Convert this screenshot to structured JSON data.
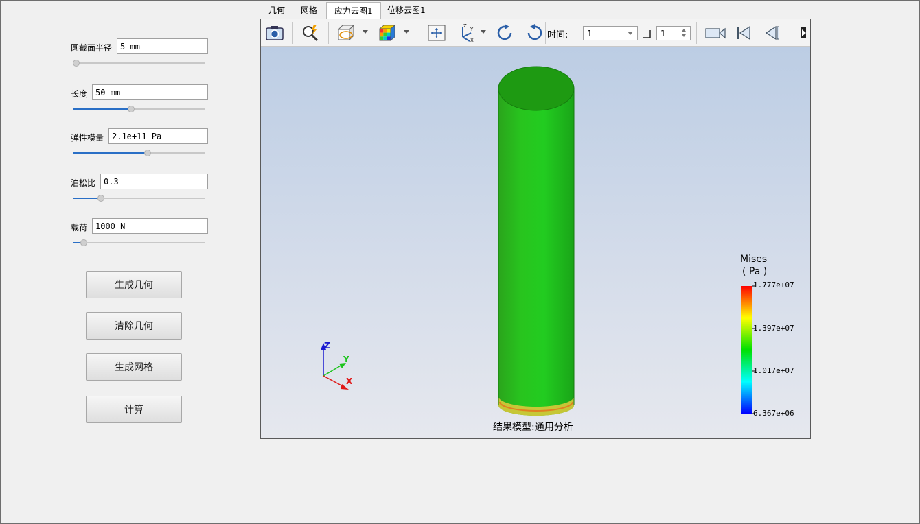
{
  "params": [
    {
      "label": "圆截面半径",
      "value": "5 mm",
      "slider": 0.02
    },
    {
      "label": "长度",
      "value": "50 mm",
      "slider": 0.44
    },
    {
      "label": "弹性模量",
      "value": "2.1e+11 Pa",
      "slider": 0.56
    },
    {
      "label": "泊松比",
      "value": "0.3",
      "slider": 0.21
    },
    {
      "label": "载荷",
      "value": "1000 N",
      "slider": 0.08
    }
  ],
  "buttons": {
    "generate_geometry": "生成几何",
    "clear_geometry": "清除几何",
    "generate_mesh": "生成网格",
    "compute": "计算"
  },
  "tabs": [
    {
      "label": "几何",
      "active": false
    },
    {
      "label": "网格",
      "active": false
    },
    {
      "label": "应力云图1",
      "active": true
    },
    {
      "label": "位移云图1",
      "active": false
    }
  ],
  "toolbar": {
    "time_label": "时间:",
    "time_value": "1",
    "step_value": "1",
    "icons": [
      "camera-icon",
      "zoom-icon",
      "section-view-icon",
      "color-cube-icon",
      "fit-view-icon",
      "axes-orientation-icon",
      "rotate-cw-icon",
      "rotate-ccw-icon",
      "record-icon",
      "first-frame-icon",
      "previous-frame-icon",
      "next-frame-icon"
    ]
  },
  "legend": {
    "title": "Mises",
    "unit": "( Pa )",
    "ticks": [
      "1.777e+07",
      "1.397e+07",
      "1.017e+07",
      "6.367e+06"
    ],
    "colors": [
      "#ff0000",
      "#ffff00",
      "#00e000",
      "#00ffff",
      "#0000ff"
    ]
  },
  "axes": {
    "x": "X",
    "y": "Y",
    "z": "Z"
  },
  "model_caption": "结果模型:通用分析",
  "colors": {
    "cylinder": "#22c822",
    "cylinder_top": "#1e9a12",
    "base_band": "#d8c83a"
  }
}
